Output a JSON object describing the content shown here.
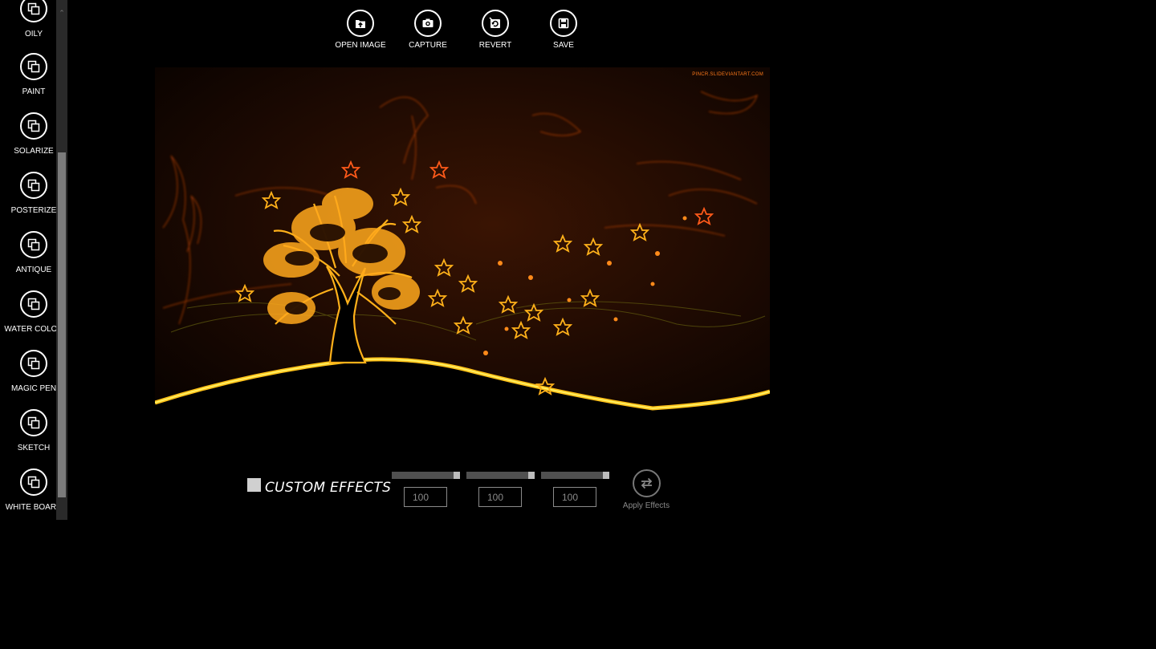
{
  "sidebar": {
    "effects": [
      {
        "label": "OILY",
        "icon": "copy-icon"
      },
      {
        "label": "PAINT",
        "icon": "copy-icon"
      },
      {
        "label": "SOLARIZE",
        "icon": "copy-icon"
      },
      {
        "label": "POSTERIZE",
        "icon": "copy-icon"
      },
      {
        "label": "ANTIQUE",
        "icon": "copy-icon"
      },
      {
        "label": "WATER COLOR",
        "icon": "copy-icon"
      },
      {
        "label": "MAGIC PEN",
        "icon": "copy-icon"
      },
      {
        "label": "SKETCH",
        "icon": "copy-icon"
      },
      {
        "label": "WHITE BOARD",
        "icon": "copy-icon"
      }
    ]
  },
  "toolbar": {
    "open_image": "OPEN IMAGE",
    "capture": "CAPTURE",
    "revert": "REVERT",
    "save": "SAVE"
  },
  "canvas": {
    "watermark": "PINCR.SLIDEVIANTART.COM",
    "accent_color": "#ff8a1a"
  },
  "custom_effects": {
    "label": "CUSTOM EFFECTS",
    "checked": false,
    "sliders": [
      {
        "value": "100",
        "level": 1.0
      },
      {
        "value": "100",
        "level": 1.0
      },
      {
        "value": "100",
        "level": 1.0
      }
    ],
    "apply_label": "Apply Effects"
  }
}
